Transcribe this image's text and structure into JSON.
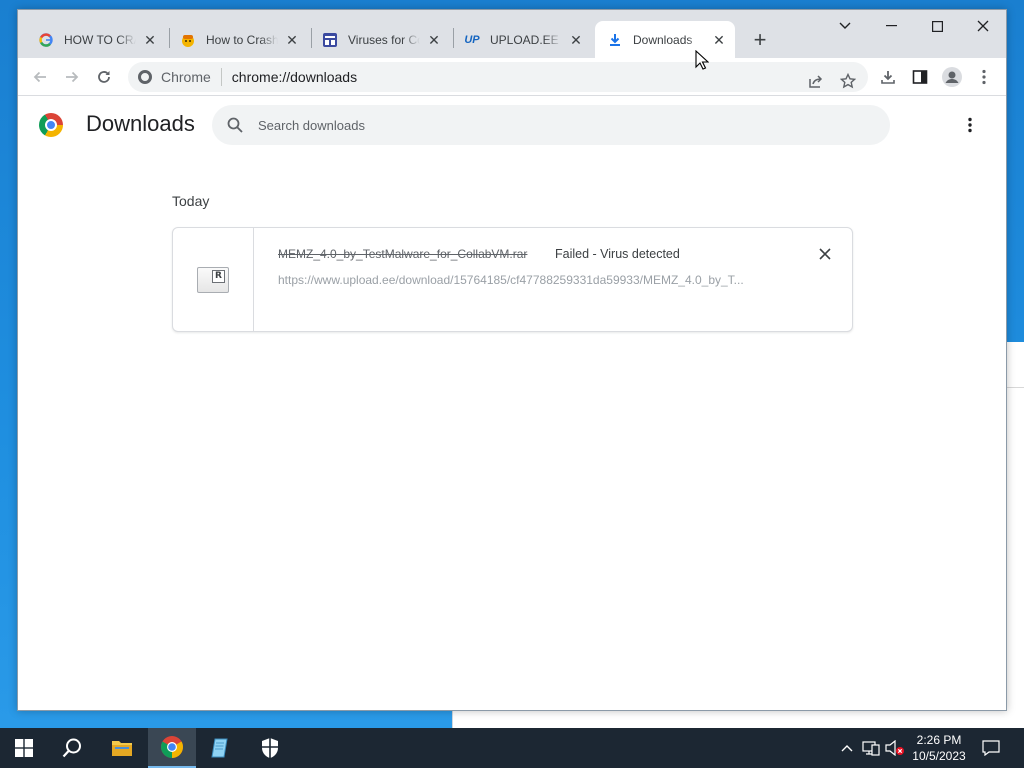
{
  "browser": {
    "tabs": [
      {
        "title": "HOW TO CRASH",
        "icon": "google-icon",
        "active": false
      },
      {
        "title": "How to Crash a",
        "icon": "emoji-icon",
        "active": false
      },
      {
        "title": "Viruses for Coll",
        "icon": "site-icon",
        "active": false
      },
      {
        "title": "UPLOAD.EE - M",
        "icon": "upload-ee-icon",
        "active": false
      },
      {
        "title": "Downloads",
        "icon": "download-icon",
        "active": true
      }
    ],
    "omnibox": {
      "chip_label": "Chrome",
      "url": "chrome://downloads"
    }
  },
  "downloads_page": {
    "title": "Downloads",
    "search_placeholder": "Search downloads",
    "section_label": "Today",
    "items": [
      {
        "file_name": "MEMZ_4.0_by_TestMalware_for_CollabVM.rar",
        "status": "Failed - Virus detected",
        "url": "https://www.upload.ee/download/15764185/cf47788259331da59933/MEMZ_4.0_by_T...",
        "file_badge": "R"
      }
    ]
  },
  "taskbar": {
    "clock_time": "2:26 PM",
    "clock_date": "10/5/2023"
  },
  "colors": {
    "accent": "#1a73e8",
    "tabstrip": "#dee1e6",
    "taskbar": "#1c2733",
    "desktop": "#1b86d6"
  }
}
